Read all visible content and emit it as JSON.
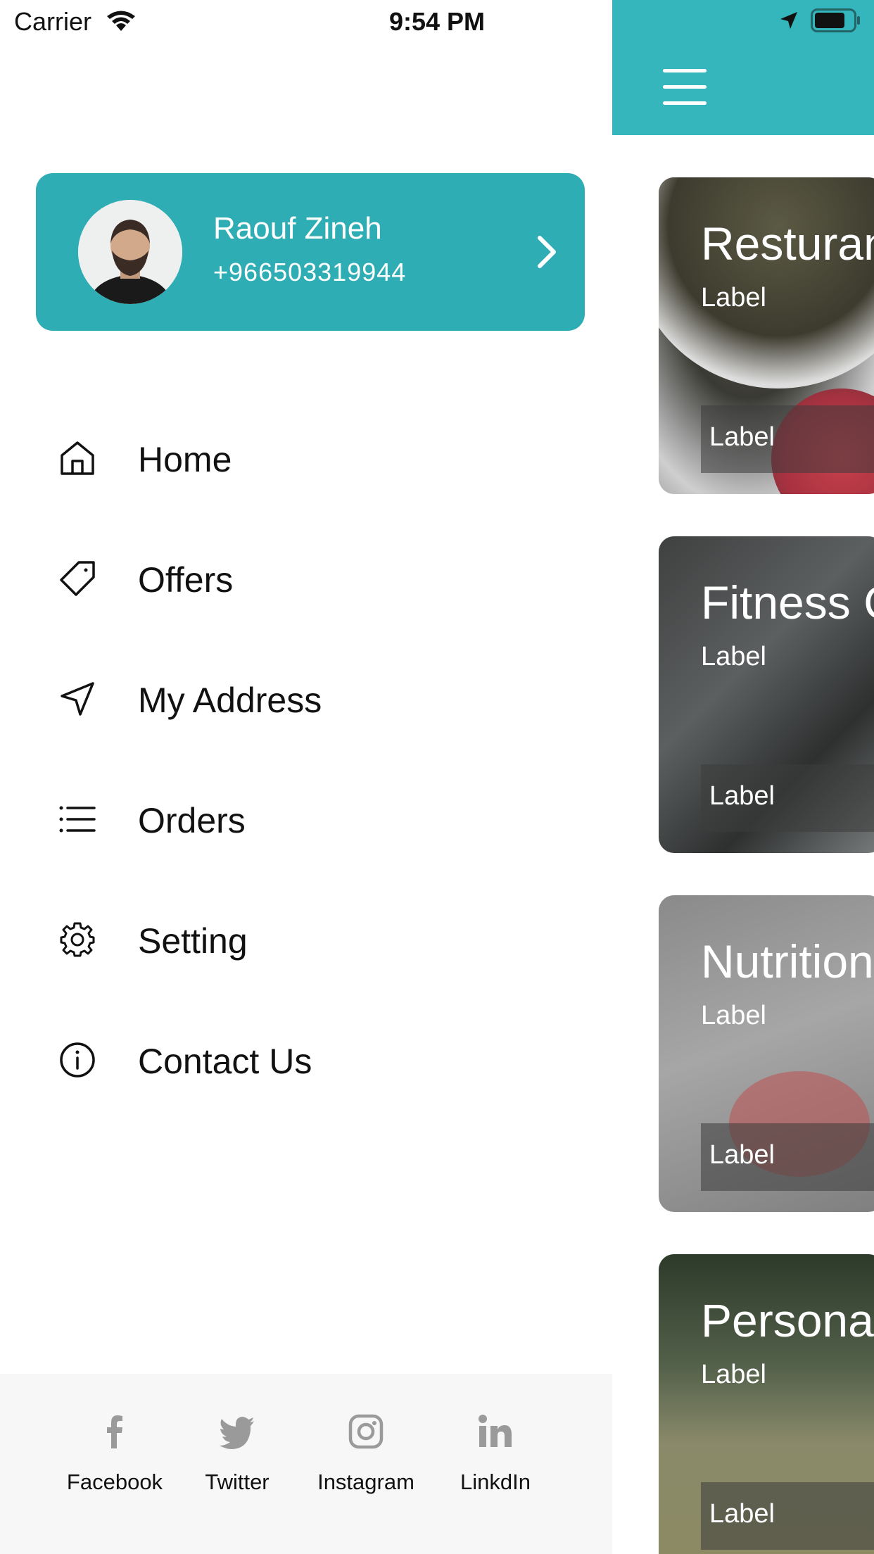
{
  "status_bar": {
    "carrier": "Carrier",
    "time": "9:54 PM"
  },
  "profile": {
    "name": "Raouf Zineh",
    "phone": "+966503319944"
  },
  "menu": {
    "items": [
      {
        "label": "Home",
        "icon": "home-icon"
      },
      {
        "label": "Offers",
        "icon": "tag-icon"
      },
      {
        "label": "My Address",
        "icon": "navigation-icon"
      },
      {
        "label": "Orders",
        "icon": "list-icon"
      },
      {
        "label": "Setting",
        "icon": "gear-icon"
      },
      {
        "label": "Contact Us",
        "icon": "info-icon"
      }
    ]
  },
  "social": {
    "items": [
      {
        "label": "Facebook",
        "icon": "facebook-icon"
      },
      {
        "label": "Twitter",
        "icon": "twitter-icon"
      },
      {
        "label": "Instagram",
        "icon": "instagram-icon"
      },
      {
        "label": "LinkdIn",
        "icon": "linkedin-icon"
      }
    ]
  },
  "main": {
    "cards": [
      {
        "title": "Resturan",
        "subtitle": "Label",
        "tag": "Label"
      },
      {
        "title": "Fitness C",
        "subtitle": "Label",
        "tag": "Label"
      },
      {
        "title": "Nutrition",
        "subtitle": "Label",
        "tag": "Label"
      },
      {
        "title": "Persona",
        "subtitle": "Label",
        "tag": "Label"
      }
    ]
  },
  "colors": {
    "accent": "#35b6bd",
    "profile_card": "#2fadb4",
    "footer_bg": "#f7f7f7"
  }
}
